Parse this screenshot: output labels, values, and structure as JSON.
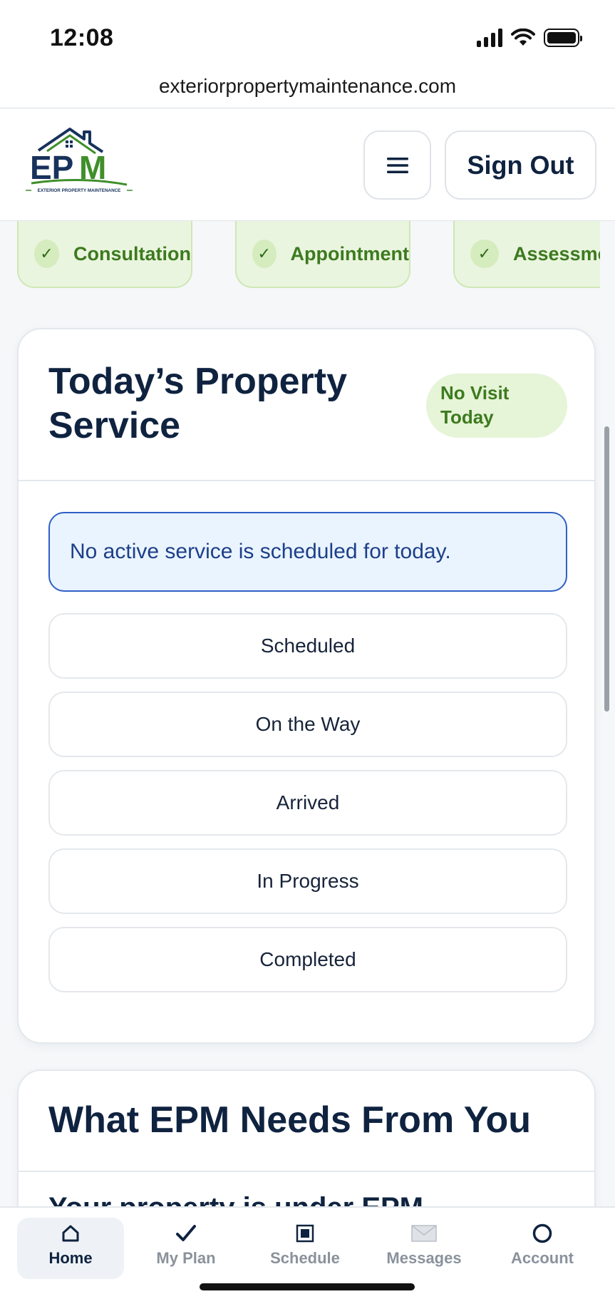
{
  "status_bar": {
    "time": "12:08"
  },
  "browser": {
    "url": "exteriorpropertymaintenance.com"
  },
  "header": {
    "logo": {
      "name": "EPM",
      "tagline": "EXTERIOR PROPERTY MAINTENANCE"
    },
    "sign_out_label": "Sign Out"
  },
  "progress_steps": [
    {
      "label": "Consultation",
      "done": true
    },
    {
      "label": "Appointment",
      "done": true
    },
    {
      "label": "Assessment",
      "done": true
    }
  ],
  "todays_service": {
    "title": "Today’s Property Service",
    "badge": "No Visit Today",
    "notice": "No active service is scheduled for today.",
    "statuses": [
      "Scheduled",
      "On the Way",
      "Arrived",
      "In Progress",
      "Completed"
    ]
  },
  "needs_section": {
    "title": "What EPM Needs From You",
    "first_line": "Your property is under EPM"
  },
  "bottom_nav": {
    "items": [
      {
        "label": "Home",
        "icon": "home-icon",
        "active": true
      },
      {
        "label": "My Plan",
        "icon": "check-icon",
        "active": false
      },
      {
        "label": "Schedule",
        "icon": "schedule-icon",
        "active": false
      },
      {
        "label": "Messages",
        "icon": "envelope-icon",
        "active": false
      },
      {
        "label": "Account",
        "icon": "account-circle-icon",
        "active": false
      }
    ]
  },
  "colors": {
    "navy": "#0f2340",
    "green": "#3d7a1f",
    "green_bg": "#eaf5df",
    "notice_blue": "#2f5fc6",
    "notice_bg": "#eaf4fe"
  }
}
